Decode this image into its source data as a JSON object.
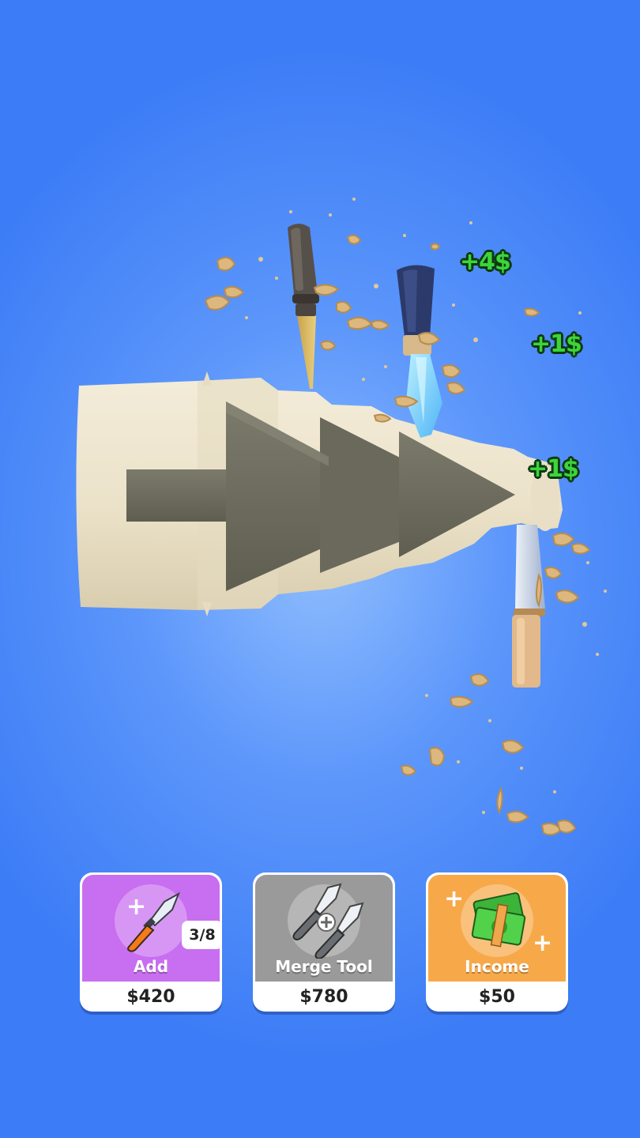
{
  "floating_rewards": [
    "+4$",
    "+1$",
    "+1$"
  ],
  "buttons": {
    "add": {
      "label": "Add",
      "price": "$420",
      "count": "3/8",
      "color": "#c86ef0",
      "icon": "chisel-icon"
    },
    "merge": {
      "label": "Merge Tool",
      "price": "$780",
      "color": "#9a9a9a",
      "icon": "merge-chisels-icon"
    },
    "income": {
      "label": "Income",
      "price": "$50",
      "color": "#f7a94a",
      "icon": "money-stack-icon"
    }
  },
  "colors": {
    "background": "#5d97fb",
    "reward_text": "#3ed43a",
    "wood": "#efe6cf",
    "carved_cone": "#6f6e60"
  }
}
